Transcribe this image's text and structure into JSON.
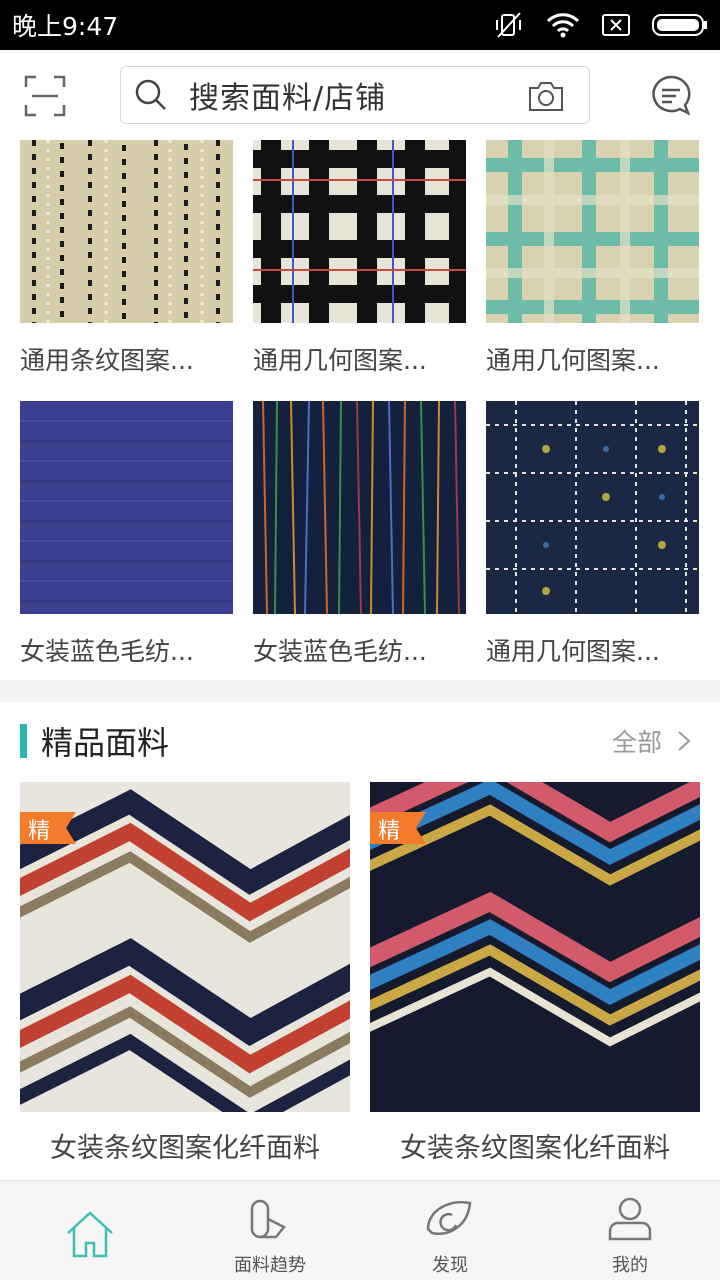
{
  "status_bar": {
    "time": "晚上9:47"
  },
  "search": {
    "placeholder": "搜索面料/店铺"
  },
  "grid_items": [
    {
      "caption": "通用条纹图案..."
    },
    {
      "caption": "通用几何图案..."
    },
    {
      "caption": "通用几何图案..."
    },
    {
      "caption": "女装蓝色毛纺..."
    },
    {
      "caption": "女装蓝色毛纺..."
    },
    {
      "caption": "通用几何图案..."
    }
  ],
  "section": {
    "title": "精品面料",
    "all_label": "全部"
  },
  "featured": [
    {
      "badge": "精",
      "caption": "女装条纹图案化纤面料"
    },
    {
      "badge": "精",
      "caption": "女装条纹图案化纤面料"
    }
  ],
  "bottom_nav": [
    {
      "label": ""
    },
    {
      "label": "面料趋势"
    },
    {
      "label": "发现"
    },
    {
      "label": "我的"
    }
  ],
  "colors": {
    "accent": "#2ab8ad",
    "badge": "#f47b2a"
  }
}
